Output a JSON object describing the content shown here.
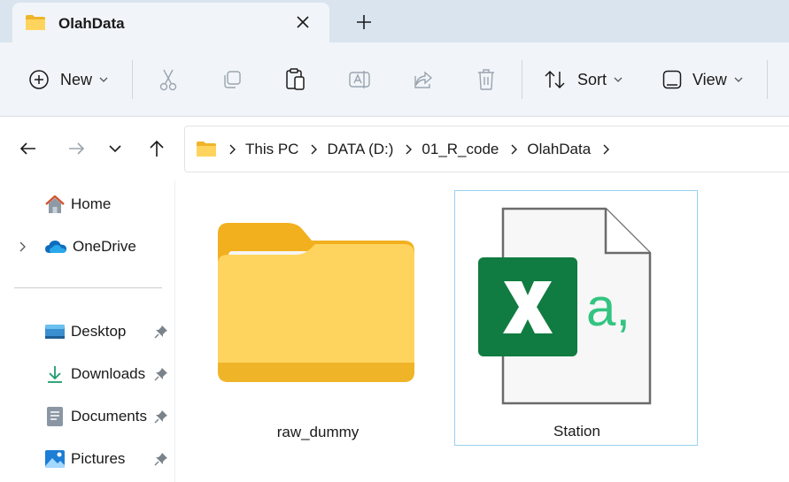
{
  "window": {
    "tab_title": "OlahData",
    "tab_icon": "folder-icon",
    "close_icon": "close-icon",
    "new_tab_icon": "plus-icon"
  },
  "toolbar": {
    "new_label": "New",
    "sort_label": "Sort",
    "view_label": "View",
    "icons": [
      "cut-icon",
      "copy-icon",
      "paste-icon",
      "rename-icon",
      "share-icon",
      "delete-icon"
    ]
  },
  "address": {
    "crumbs": [
      "This PC",
      "DATA (D:)",
      "01_R_code",
      "OlahData"
    ]
  },
  "sidebar": {
    "items": [
      {
        "label": "Home",
        "icon": "home-icon"
      },
      {
        "label": "OneDrive",
        "icon": "cloud-icon"
      },
      {
        "label": "Desktop",
        "icon": "desktop-icon"
      },
      {
        "label": "Downloads",
        "icon": "download-icon"
      },
      {
        "label": "Documents",
        "icon": "document-icon"
      },
      {
        "label": "Pictures",
        "icon": "pictures-icon"
      }
    ]
  },
  "files": [
    {
      "name": "raw_dummy",
      "type": "folder"
    },
    {
      "name": "Station",
      "type": "csv",
      "selected": true
    }
  ],
  "colors": {
    "accent": "#0f6cbd",
    "excel_green": "#107c41",
    "folder_yellow": "#ffc83d",
    "selection_border": "#99d1f0"
  }
}
